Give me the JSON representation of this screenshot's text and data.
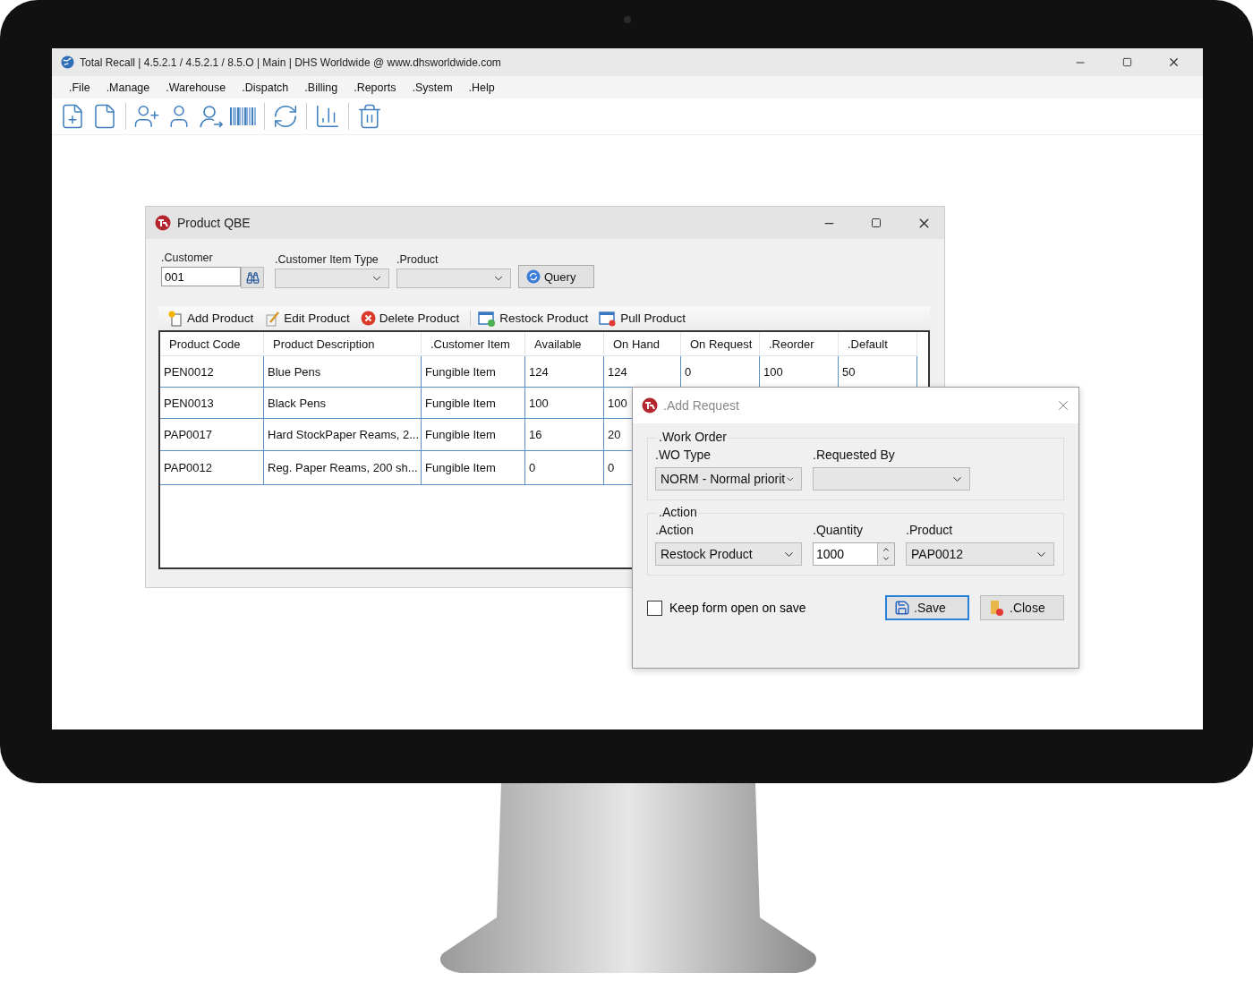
{
  "window": {
    "title": "Total Recall | 4.5.2.1 / 4.5.2.1 / 8.5.O | Main | DHS Worldwide @ www.dhsworldwide.com"
  },
  "menu": [
    ".File",
    ".Manage",
    ".Warehouse",
    ".Dispatch",
    ".Billing",
    ".Reports",
    ".System",
    ".Help"
  ],
  "qbe_window": {
    "title": "Product QBE",
    "filters": [
      {
        "kind": "text",
        "label": ".Customer",
        "value": "001"
      },
      {
        "kind": "combo",
        "label": ".Customer Item Type"
      },
      {
        "kind": "combo",
        "label": ".Product"
      }
    ],
    "query_button": "Query",
    "actions": [
      "Add Product",
      "Edit Product",
      "Delete Product",
      "Restock Product",
      "Pull Product"
    ],
    "table": {
      "columns": [
        "Product Code",
        "Product Description",
        ".Customer Item",
        "Available",
        "On Hand",
        "On Request",
        ".Reorder",
        ".Default"
      ],
      "rows": [
        {
          "cells": [
            "PEN0012",
            "Blue Pens",
            "Fungible Item",
            "124",
            "124",
            "0",
            "100",
            "50"
          ]
        },
        {
          "cells": [
            "PEN0013",
            "Black Pens",
            "Fungible Item",
            "100",
            "100"
          ]
        },
        {
          "cells": [
            "PAP0017",
            "Hard StockPaper Reams, 2...",
            "Fungible Item",
            "16",
            "20"
          ]
        },
        {
          "cells": [
            "PAP0012",
            "Reg. Paper Reams, 200 sh...",
            "Fungible Item",
            "0",
            "0"
          ]
        }
      ]
    }
  },
  "add_request": {
    "title": ".Add Request",
    "groups": [
      {
        "title": ".Work Order",
        "fields": [
          {
            "kind": "combo",
            "label": ".WO Type",
            "value": "NORM - Normal priorit"
          },
          {
            "kind": "combo",
            "label": ".Requested By"
          }
        ]
      },
      {
        "title": ".Action",
        "fields": [
          {
            "kind": "combo",
            "label": ".Action",
            "value": "Restock Product"
          },
          {
            "kind": "spin",
            "label": ".Quantity",
            "value": "1000"
          },
          {
            "kind": "combo",
            "label": ".Product",
            "value": "PAP0012"
          }
        ]
      }
    ],
    "keep_open": {
      "label": "Keep form open on save",
      "checked": false
    },
    "buttons": [
      {
        "kind": "save",
        "label": ".Save",
        "selected": true
      },
      {
        "kind": "close",
        "label": ".Close",
        "selected": false
      }
    ]
  }
}
